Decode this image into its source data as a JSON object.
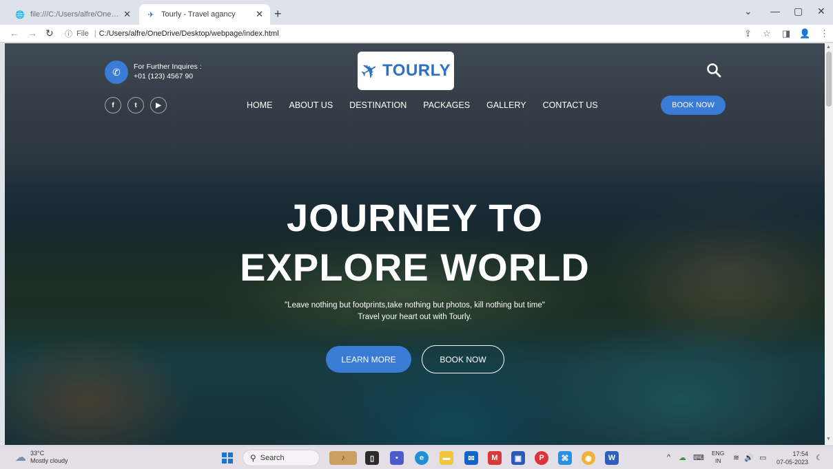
{
  "browser": {
    "tabs": [
      {
        "title": "file:///C:/Users/alfre/OneDrive/Desktop/webpage/index.html",
        "favicon": "globe-icon",
        "close": "✕"
      },
      {
        "title": "Tourly - Travel agancy",
        "favicon": "plane-icon",
        "close": "✕"
      }
    ],
    "new_tab": "+",
    "address": {
      "scheme": "File",
      "url": "C:/Users/alfre/OneDrive/Desktop/webpage/index.html"
    }
  },
  "page": {
    "inquiry": {
      "label": "For Further Inquires :",
      "phone": "+01 (123) 4567 90"
    },
    "logo": {
      "brand": "TOURLY"
    },
    "social": [
      "facebook-icon",
      "twitter-icon",
      "youtube-icon"
    ],
    "nav": [
      "HOME",
      "ABOUT US",
      "DESTINATION",
      "PACKAGES",
      "GALLERY",
      "CONTACT US"
    ],
    "book_now_top": "BOOK NOW",
    "hero": {
      "title_line1": "JOURNEY TO",
      "title_line2": "EXPLORE WORLD",
      "quote": "\"Leave nothing but footprints,take nothing but photos, kill nothing but time\"",
      "tagline": "Travel your heart out with Tourly.",
      "learn_more": "LEARN MORE",
      "book_now": "BOOK NOW"
    },
    "accent_color": "#3a7bd5"
  },
  "taskbar": {
    "weather": {
      "temp": "33°C",
      "condition": "Mostly cloudy"
    },
    "search_placeholder": "Search",
    "lang": {
      "line1": "ENG",
      "line2": "IN"
    },
    "clock": {
      "time": "17:54",
      "date": "07-05-2023"
    }
  }
}
